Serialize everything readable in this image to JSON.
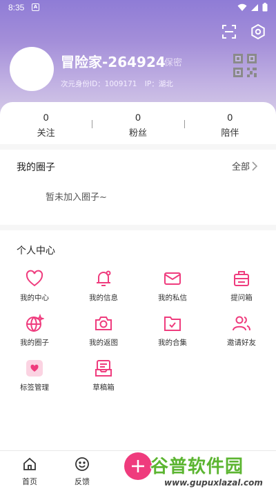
{
  "status_bar": {
    "time": "8:35",
    "notification_glyph": "A"
  },
  "profile": {
    "username": "冒险家-264924",
    "gender": "保密",
    "id_label": "次元身份ID：1009171",
    "ip_label": "IP：湖北"
  },
  "stats": [
    {
      "value": "0",
      "label": "关注"
    },
    {
      "value": "0",
      "label": "粉丝"
    },
    {
      "value": "0",
      "label": "陪伴"
    }
  ],
  "circles": {
    "title": "我的圈子",
    "all_label": "全部",
    "empty_text": "暂未加入圈子~"
  },
  "personal_center": {
    "title": "个人中心",
    "items": [
      {
        "label": "我的中心",
        "icon": "heart-icon"
      },
      {
        "label": "我的信息",
        "icon": "bell-icon"
      },
      {
        "label": "我的私信",
        "icon": "mail-icon"
      },
      {
        "label": "提问箱",
        "icon": "question-box-icon"
      },
      {
        "label": "我的圈子",
        "icon": "globe-sparkle-icon"
      },
      {
        "label": "我的返图",
        "icon": "camera-icon"
      },
      {
        "label": "我的合集",
        "icon": "folder-check-icon"
      },
      {
        "label": "邀请好友",
        "icon": "invite-friends-icon"
      },
      {
        "label": "标签管理",
        "icon": "tag-heart-icon"
      },
      {
        "label": "草稿箱",
        "icon": "draft-box-icon"
      }
    ]
  },
  "tabbar": {
    "items": [
      {
        "label": "首页",
        "icon": "home-icon"
      },
      {
        "label": "反馈",
        "icon": "smiley-icon"
      }
    ],
    "fab_icon": "plus-icon"
  },
  "watermark": {
    "title": "谷普软件园",
    "url": "www.gupuxlazal.com"
  },
  "colors": {
    "accent": "#ef3b7d",
    "header_top": "#8f7cd6",
    "header_bottom": "#d8cfe8"
  }
}
